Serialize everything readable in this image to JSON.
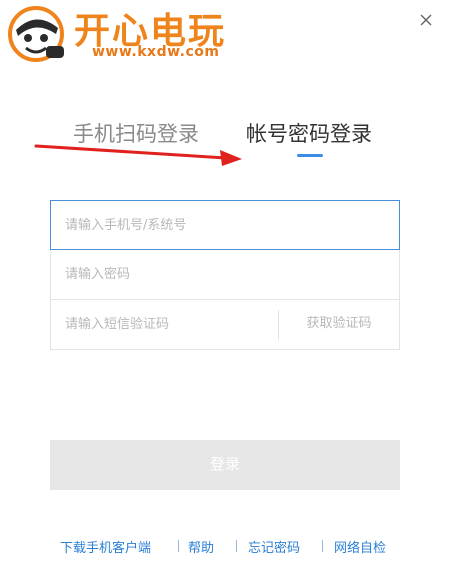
{
  "logo": {
    "brand_text": "开心电玩",
    "url_text": "www.kxdw.com",
    "mascot_icon": "mascot-icon"
  },
  "window": {
    "close_icon": "close-icon"
  },
  "tabs": [
    {
      "label": "手机扫码登录",
      "active": false
    },
    {
      "label": "帐号密码登录",
      "active": true
    }
  ],
  "form": {
    "phone_placeholder": "请输入手机号/系统号",
    "phone_value": "",
    "password_placeholder": "请输入密码",
    "password_value": "",
    "sms_placeholder": "请输入短信验证码",
    "sms_value": "",
    "sms_button_label": "获取验证码",
    "login_label": "登录"
  },
  "footer": {
    "links": [
      {
        "label": "下载手机客户端"
      },
      {
        "label": "帮助"
      },
      {
        "label": "忘记密码"
      },
      {
        "label": "网络自检"
      }
    ]
  },
  "colors": {
    "accent": "#3a8ee6",
    "link": "#2a7fd4",
    "brand_orange": "#f0841c",
    "annotation_arrow": "#e0211d"
  }
}
